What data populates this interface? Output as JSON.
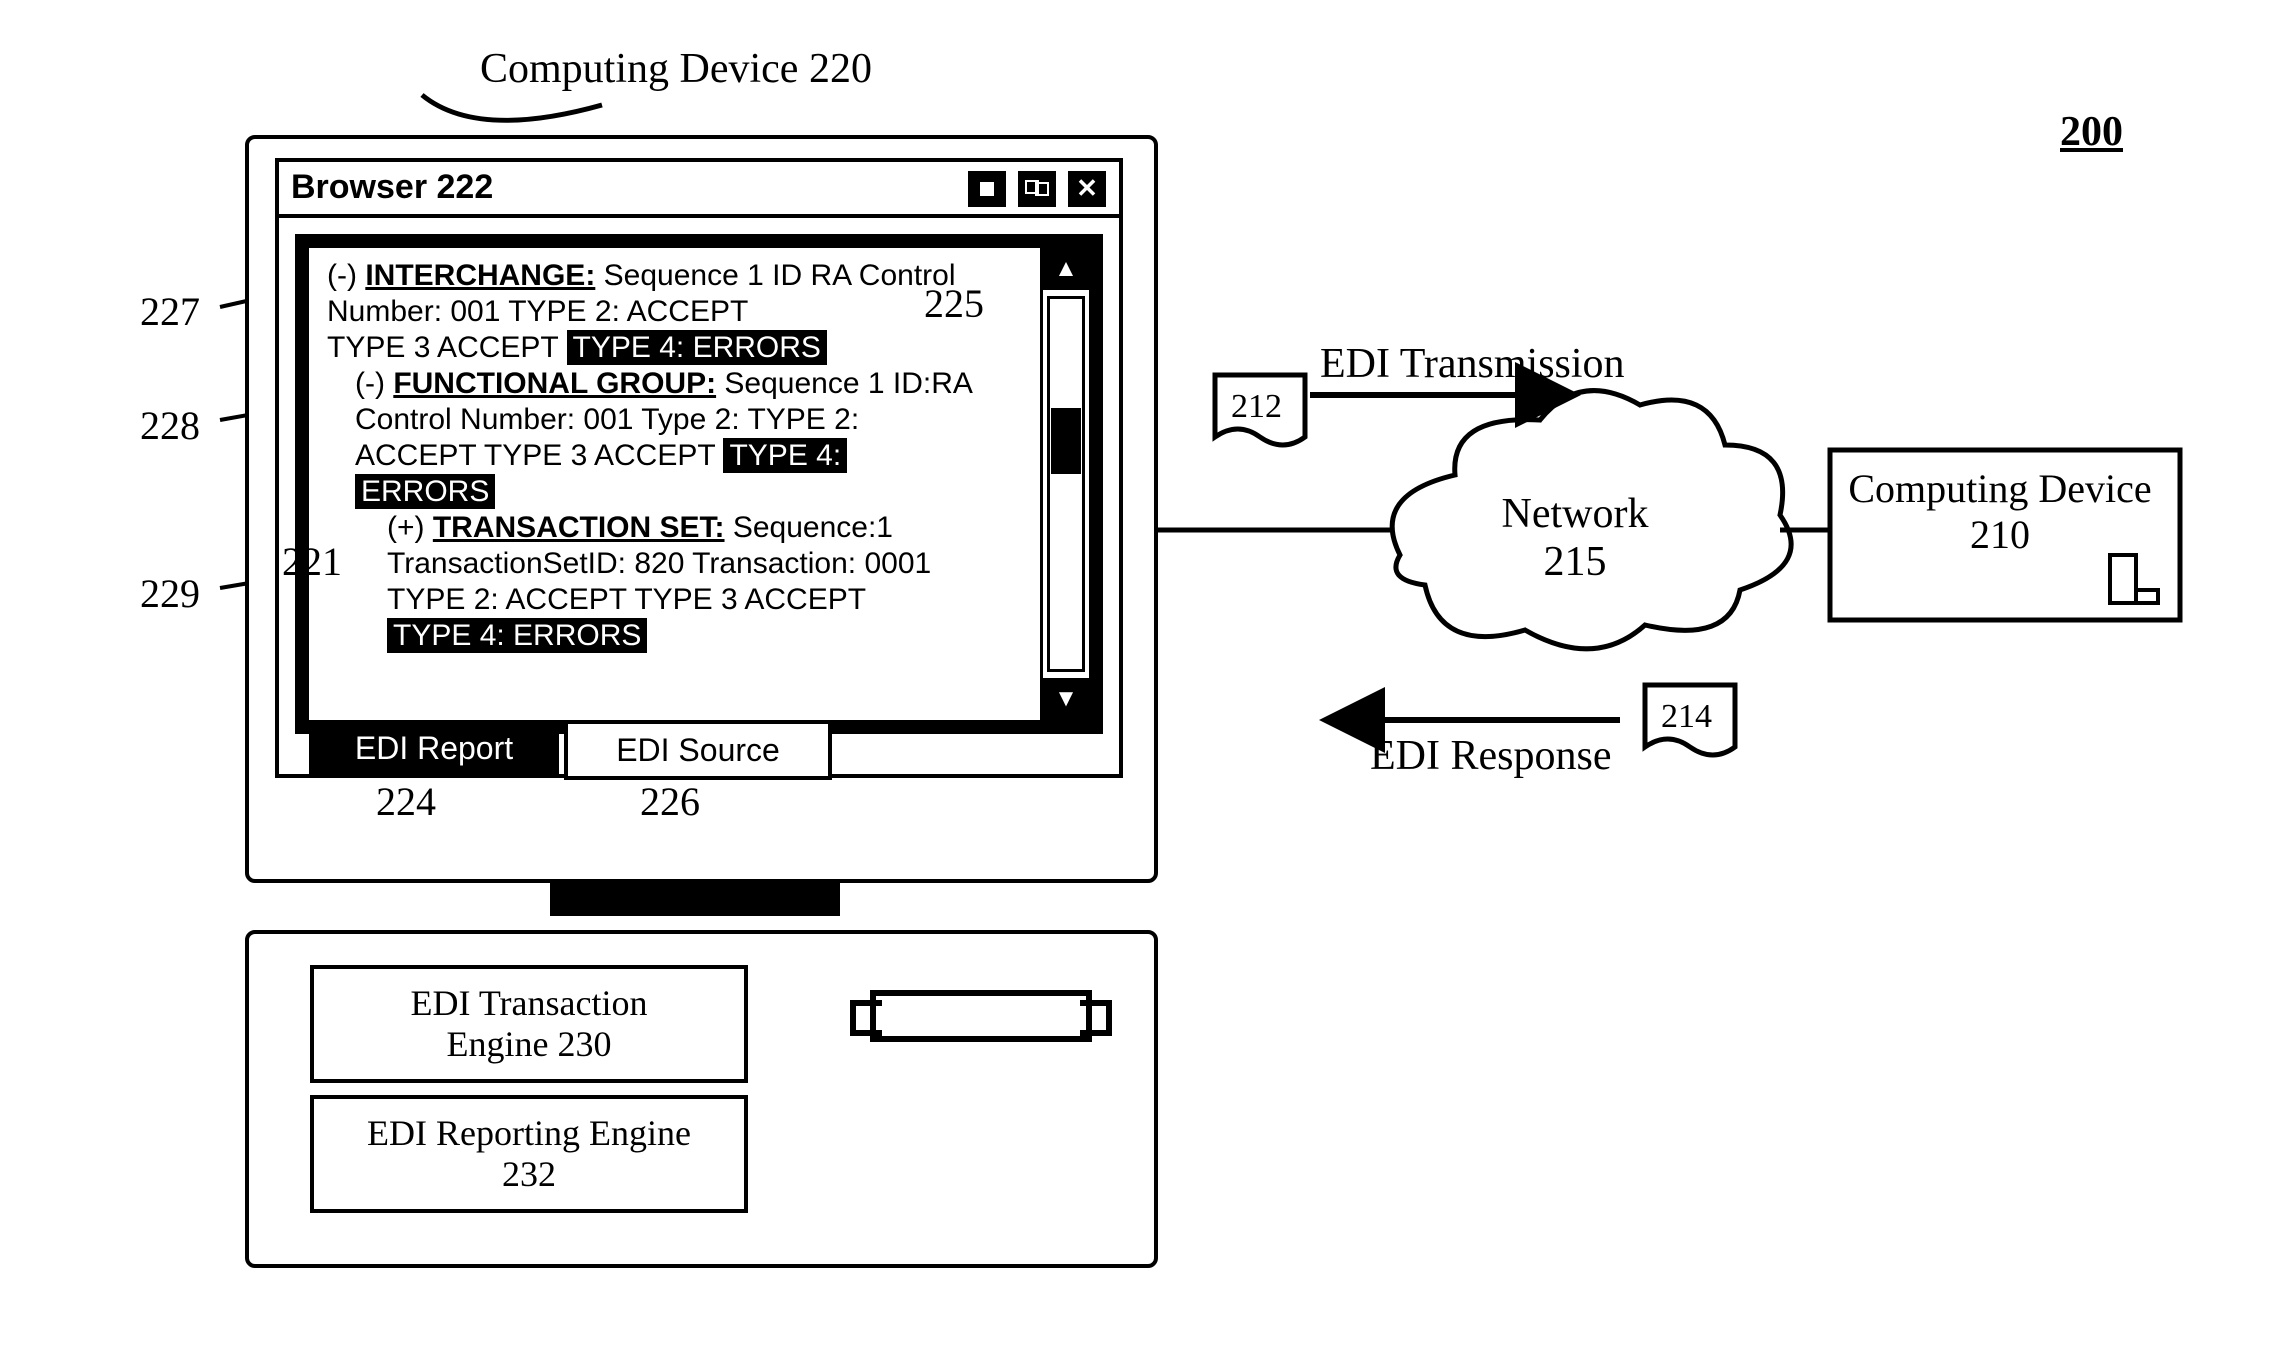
{
  "figure_number": "200",
  "computing_device_220_label": "Computing Device 220",
  "browser_title": "Browser 222",
  "tab_report": "EDI Report",
  "tab_source": "EDI Source",
  "interchange_header": "INTERCHANGE:",
  "interchange_rest": " Sequence 1 ID RA Control",
  "interchange_l2": "Number: 001  TYPE 2: ACCEPT",
  "interchange_l3a": "TYPE 3 ACCEPT ",
  "interchange_l3b": "TYPE 4: ERRORS",
  "fg_header": "FUNCTIONAL GROUP:",
  "fg_rest": " Sequence 1 ID:RA",
  "fg_l2": "Control Number: 001 Type 2: TYPE 2:",
  "fg_l3a": "ACCEPT TYPE 3 ACCEPT  ",
  "fg_l3b": "TYPE 4:",
  "fg_l4": "ERRORS",
  "ts_header": "TRANSACTION SET:",
  "ts_rest": " Sequence:1",
  "ts_l2": "TransactionSetID: 820  Transaction: 0001",
  "ts_l3": "TYPE 2: ACCEPT TYPE 3 ACCEPT",
  "ts_l4": "TYPE 4: ERRORS",
  "engine_transaction": "EDI Transaction\nEngine 230",
  "engine_reporting": "EDI Reporting Engine\n232",
  "edi_transmission": "EDI Transmission",
  "edi_response": "EDI Response",
  "network_label": "Network\n215",
  "computing_device_210": "Computing Device\n210",
  "ref_212": "212",
  "ref_214": "214",
  "ref_221": "221",
  "ref_224": "224",
  "ref_225": "225",
  "ref_226": "226",
  "ref_227": "227",
  "ref_228": "228",
  "ref_229": "229"
}
